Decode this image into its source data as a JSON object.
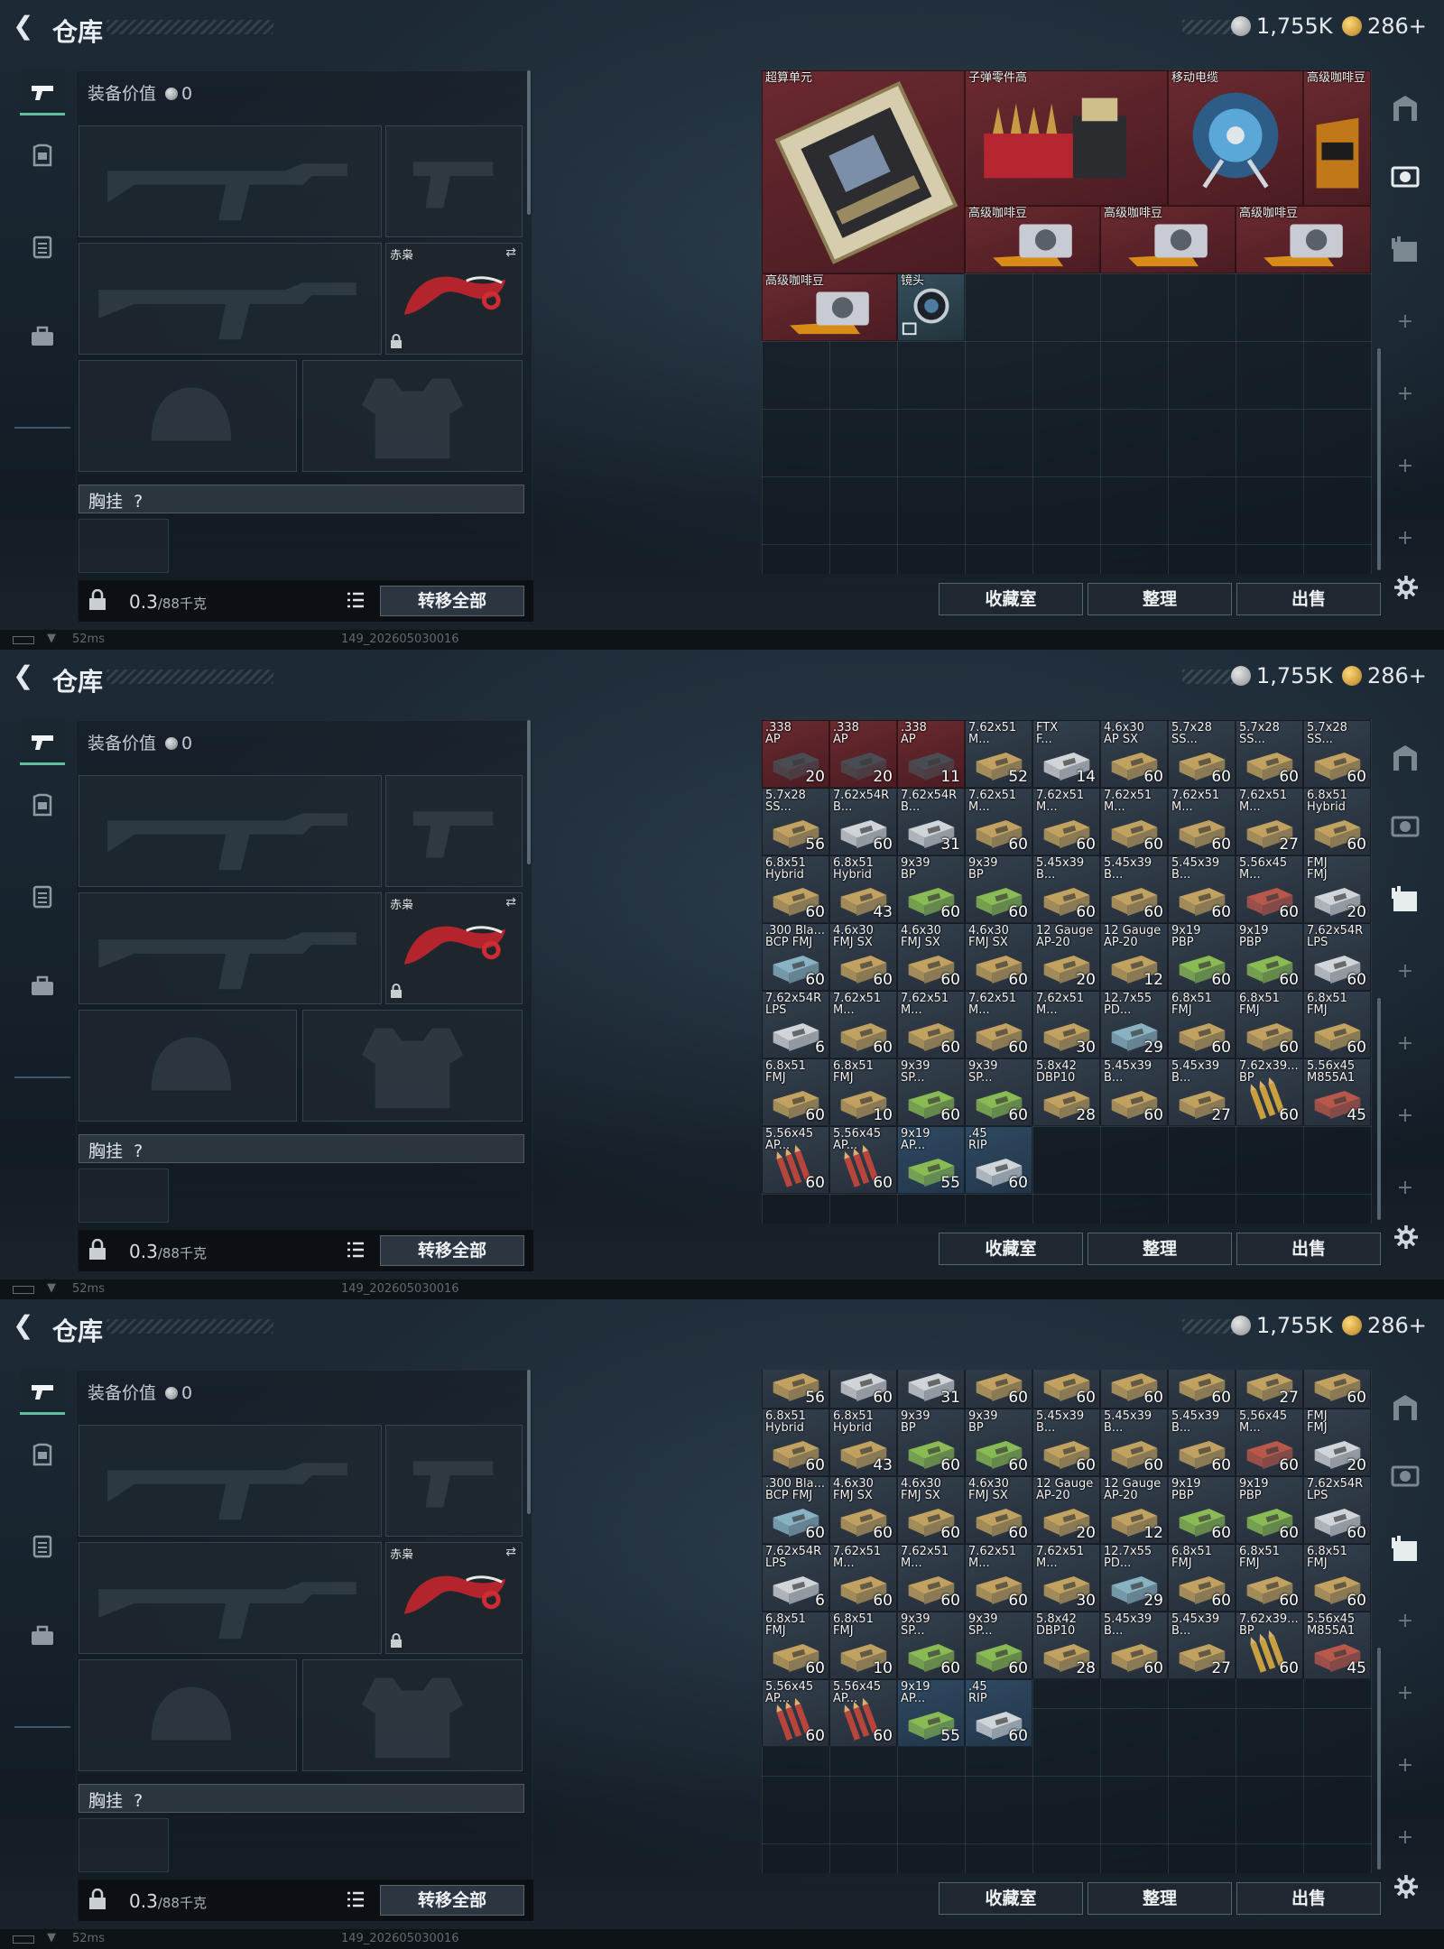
{
  "app": {
    "title": "仓库"
  },
  "currency": {
    "silver": "1,755K",
    "gold": "286+"
  },
  "equipment": {
    "value_label": "装备价值",
    "value": "0",
    "melee_name": "赤枭",
    "chest_label": "胸挂",
    "help": "?",
    "weight": "0.3",
    "weight_unit": "/88千克",
    "transfer_all": "转移全部"
  },
  "stash": {
    "collection_btn": "收藏室",
    "sort_btn": "整理",
    "sell_btn": "出售"
  },
  "status": {
    "ping": "52ms",
    "build": "149_202605030016"
  },
  "colors": {
    "accent": "#5fc19e",
    "rare_bg": "#5a2228",
    "ammo_bg": "#2e3a48",
    "teal_bg": "#2c4450",
    "sel_bg": "#2a3e52"
  },
  "screen1_items": [
    {
      "name": "超算单元",
      "label": "超算单元",
      "count": "",
      "col": 0,
      "row": 0,
      "w": 3,
      "h": 3,
      "bg": "rare",
      "icon": "mainboard"
    },
    {
      "name": "子弹零件高",
      "label": "子弹零件高",
      "count": "",
      "col": 3,
      "row": 0,
      "w": 3,
      "h": 2,
      "bg": "rare",
      "icon": "parts"
    },
    {
      "name": "移动电缆",
      "label": "移动电缆",
      "count": "",
      "col": 6,
      "row": 0,
      "w": 2,
      "h": 2,
      "bg": "rare",
      "icon": "reel"
    },
    {
      "name": "高级咖啡豆",
      "label": "高级咖啡豆",
      "count": "",
      "col": 8,
      "row": 0,
      "w": 1,
      "h": 2,
      "bg": "rare",
      "icon": "coffee"
    },
    {
      "name": "高级咖啡豆",
      "label": "高级咖啡豆",
      "count": "",
      "col": 3,
      "row": 2,
      "w": 2,
      "h": 1,
      "bg": "rare",
      "icon": "coffeebox"
    },
    {
      "name": "高级咖啡豆",
      "label": "高级咖啡豆",
      "count": "",
      "col": 5,
      "row": 2,
      "w": 2,
      "h": 1,
      "bg": "rare",
      "icon": "coffeebox"
    },
    {
      "name": "高级咖啡豆",
      "label": "高级咖啡豆",
      "count": "",
      "col": 7,
      "row": 2,
      "w": 2,
      "h": 1,
      "bg": "rare",
      "icon": "coffeebox"
    },
    {
      "name": "高级咖啡豆",
      "label": "高级咖啡豆",
      "count": "",
      "col": 0,
      "row": 3,
      "w": 2,
      "h": 1,
      "bg": "rare",
      "icon": "coffeebox"
    },
    {
      "name": "镜头",
      "label": "镜头",
      "count": "",
      "col": 2,
      "row": 3,
      "w": 1,
      "h": 1,
      "bg": "teal",
      "icon": "lens"
    }
  ],
  "ammo_rows": [
    [
      [
        ".338",
        "AP",
        "20",
        "dark"
      ],
      [
        ".338",
        "AP",
        "20",
        "dark"
      ],
      [
        ".338",
        "AP",
        "11",
        "dark"
      ],
      [
        "7.62x51",
        "M...",
        "52",
        "tan"
      ],
      [
        "FTX",
        "F...",
        "14",
        "white"
      ],
      [
        "4.6x30",
        "AP SX",
        "60",
        "tan"
      ],
      [
        "5.7x28",
        "SS...",
        "60",
        "tan"
      ],
      [
        "5.7x28",
        "SS...",
        "60",
        "tan"
      ],
      [
        "5.7x28",
        "SS...",
        "60",
        "tan"
      ]
    ],
    [
      [
        "5.7x28",
        "SS...",
        "56",
        "tan"
      ],
      [
        "7.62x54R",
        "B...",
        "60",
        "white"
      ],
      [
        "7.62x54R",
        "B...",
        "31",
        "white"
      ],
      [
        "7.62x51",
        "M...",
        "60",
        "tan"
      ],
      [
        "7.62x51",
        "M...",
        "60",
        "tan"
      ],
      [
        "7.62x51",
        "M...",
        "60",
        "tan"
      ],
      [
        "7.62x51",
        "M...",
        "60",
        "tan"
      ],
      [
        "7.62x51",
        "M...",
        "27",
        "tan"
      ],
      [
        "6.8x51",
        "Hybrid",
        "60",
        "tan"
      ]
    ],
    [
      [
        "6.8x51",
        "Hybrid",
        "60",
        "tan"
      ],
      [
        "6.8x51",
        "Hybrid",
        "43",
        "tan"
      ],
      [
        "9x39",
        "BP",
        "60",
        "green"
      ],
      [
        "9x39",
        "BP",
        "60",
        "green"
      ],
      [
        "5.45x39",
        "B...",
        "60",
        "tan"
      ],
      [
        "5.45x39",
        "B...",
        "60",
        "tan"
      ],
      [
        "5.45x39",
        "B...",
        "60",
        "tan"
      ],
      [
        "5.56x45",
        "M...",
        "60",
        "red"
      ],
      [
        "FMJ",
        "FMJ",
        "20",
        "white"
      ]
    ],
    [
      [
        ".300 Bla...",
        "BCP FMJ",
        "60",
        "teal"
      ],
      [
        "4.6x30",
        "FMJ SX",
        "60",
        "tan"
      ],
      [
        "4.6x30",
        "FMJ SX",
        "60",
        "tan"
      ],
      [
        "4.6x30",
        "FMJ SX",
        "60",
        "tan"
      ],
      [
        "12 Gauge",
        "AP-20",
        "20",
        "tan"
      ],
      [
        "12 Gauge",
        "AP-20",
        "12",
        "tan"
      ],
      [
        "9x19",
        "PBP",
        "60",
        "green"
      ],
      [
        "9x19",
        "PBP",
        "60",
        "green"
      ],
      [
        "7.62x54R",
        "LPS",
        "60",
        "white"
      ]
    ],
    [
      [
        "7.62x54R",
        "LPS",
        "6",
        "white"
      ],
      [
        "7.62x51",
        "M...",
        "60",
        "tan"
      ],
      [
        "7.62x51",
        "M...",
        "60",
        "tan"
      ],
      [
        "7.62x51",
        "M...",
        "60",
        "tan"
      ],
      [
        "7.62x51",
        "M...",
        "30",
        "tan"
      ],
      [
        "12.7x55",
        "PD...",
        "29",
        "teal"
      ],
      [
        "6.8x51",
        "FMJ",
        "60",
        "tan"
      ],
      [
        "6.8x51",
        "FMJ",
        "60",
        "tan"
      ],
      [
        "6.8x51",
        "FMJ",
        "60",
        "tan"
      ]
    ],
    [
      [
        "6.8x51",
        "FMJ",
        "60",
        "tan"
      ],
      [
        "6.8x51",
        "FMJ",
        "10",
        "tan"
      ],
      [
        "9x39",
        "SP...",
        "60",
        "green"
      ],
      [
        "9x39",
        "SP...",
        "60",
        "green"
      ],
      [
        "5.8x42",
        "DBP10",
        "28",
        "tan"
      ],
      [
        "5.45x39",
        "B...",
        "60",
        "tan"
      ],
      [
        "5.45x39",
        "B...",
        "27",
        "tan"
      ],
      [
        "7.62x39...",
        "BP",
        "60",
        "loose"
      ],
      [
        "5.56x45",
        "M855A1",
        "45",
        "red"
      ]
    ],
    [
      [
        "5.56x45",
        "AP...",
        "60",
        "redloose"
      ],
      [
        "5.56x45",
        "AP...",
        "60",
        "redloose"
      ],
      [
        "9x19",
        "AP...",
        "55",
        "green"
      ],
      [
        ".45",
        "RIP",
        "60",
        "white"
      ]
    ]
  ]
}
